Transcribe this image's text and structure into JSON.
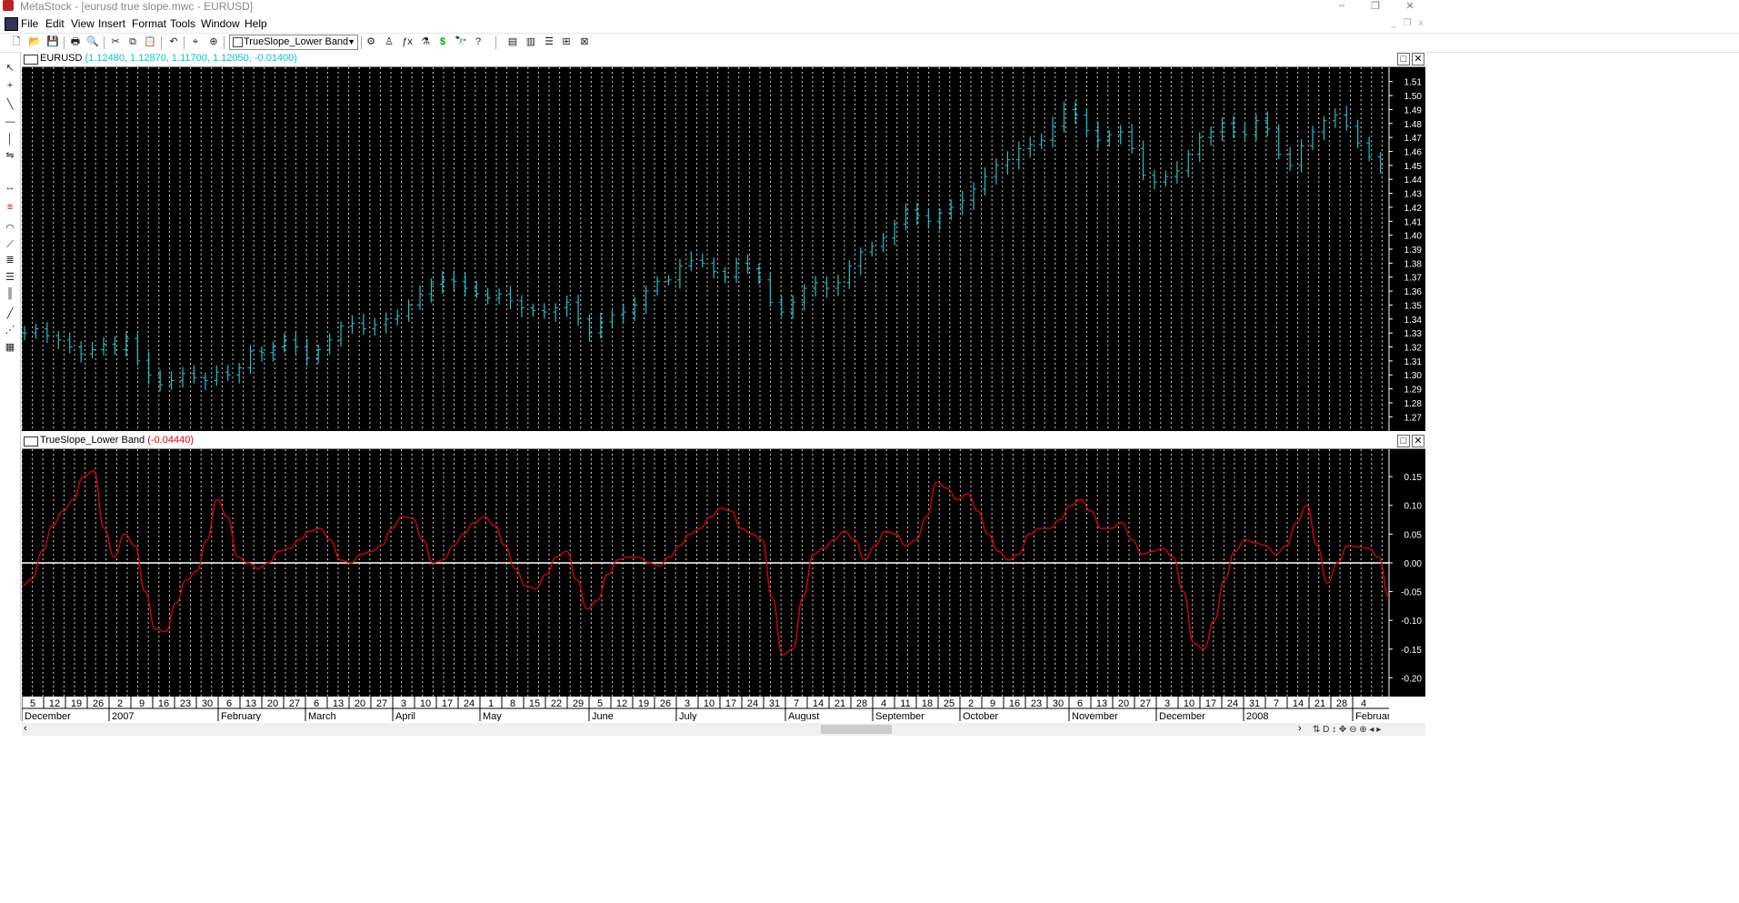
{
  "app": {
    "title": "MetaStock - [eurusd true slope.mwc - EURUSD]",
    "minimize": "–",
    "restore": "❐",
    "close": "✕"
  },
  "menu": [
    "File",
    "Edit",
    "View",
    "Insert",
    "Format",
    "Tools",
    "Window",
    "Help"
  ],
  "toolbar": {
    "indicator_combo": "TrueSlope_Lower Band"
  },
  "price_pane": {
    "symbol": "EURUSD",
    "values": "(1.12480, 1.12870, 1.11700, 1.12050, -0.01400)",
    "value_color": "#00c8c8",
    "bar_color": "#20c0c8",
    "y_ticks": [
      "1.51",
      "1.50",
      "1.49",
      "1.48",
      "1.47",
      "1.46",
      "1.45",
      "1.44",
      "1.43",
      "1.42",
      "1.41",
      "1.40",
      "1.39",
      "1.38",
      "1.37",
      "1.36",
      "1.35",
      "1.34",
      "1.33",
      "1.32",
      "1.31",
      "1.30",
      "1.29",
      "1.28",
      "1.27"
    ]
  },
  "indicator_pane": {
    "name": "TrueSlope_Lower Band",
    "value": "(-0.04440)",
    "value_color": "#e00000",
    "line_color": "#e00000",
    "zero_line_color": "#ffffff",
    "y_ticks": [
      "0.15",
      "0.10",
      "0.05",
      "0.00",
      "-0.05",
      "-0.10",
      "-0.15",
      "-0.20"
    ]
  },
  "x_axis": {
    "day_ticks": [
      "5",
      "12",
      "19",
      "26",
      "2",
      "9",
      "16",
      "23",
      "30",
      "6",
      "13",
      "20",
      "27",
      "6",
      "13",
      "20",
      "27",
      "3",
      "10",
      "17",
      "24",
      "1",
      "8",
      "15",
      "22",
      "29",
      "5",
      "12",
      "19",
      "26",
      "3",
      "10",
      "17",
      "24",
      "31",
      "7",
      "14",
      "21",
      "28",
      "4",
      "11",
      "18",
      "25",
      "2",
      "9",
      "16",
      "23",
      "30",
      "6",
      "13",
      "20",
      "27",
      "3",
      "10",
      "17",
      "24",
      "31",
      "7",
      "14",
      "21",
      "28",
      "4"
    ],
    "months": [
      {
        "label": "December",
        "tick": 0
      },
      {
        "label": "2007",
        "tick": 4
      },
      {
        "label": "February",
        "tick": 9
      },
      {
        "label": "March",
        "tick": 13
      },
      {
        "label": "April",
        "tick": 17
      },
      {
        "label": "May",
        "tick": 21
      },
      {
        "label": "June",
        "tick": 26
      },
      {
        "label": "July",
        "tick": 30
      },
      {
        "label": "August",
        "tick": 35
      },
      {
        "label": "September",
        "tick": 39
      },
      {
        "label": "October",
        "tick": 43
      },
      {
        "label": "November",
        "tick": 48
      },
      {
        "label": "December",
        "tick": 52
      },
      {
        "label": "2008",
        "tick": 56
      },
      {
        "label": "February",
        "tick": 61
      }
    ]
  },
  "chart_data": {
    "type": "line",
    "price_series": {
      "name": "EURUSD",
      "close_points": [
        1.33,
        1.333,
        1.328,
        1.325,
        1.32,
        1.315,
        1.318,
        1.322,
        1.318,
        1.326,
        1.31,
        1.3,
        1.293,
        1.296,
        1.301,
        1.298,
        1.296,
        1.302,
        1.3,
        1.305,
        1.317,
        1.316,
        1.32,
        1.325,
        1.32,
        1.312,
        1.318,
        1.325,
        1.335,
        1.337,
        1.333,
        1.336,
        1.34,
        1.342,
        1.35,
        1.358,
        1.365,
        1.368,
        1.367,
        1.362,
        1.358,
        1.355,
        1.358,
        1.353,
        1.348,
        1.346,
        1.345,
        1.348,
        1.352,
        1.34,
        1.33,
        1.338,
        1.343,
        1.345,
        1.35,
        1.36,
        1.367,
        1.368,
        1.378,
        1.382,
        1.38,
        1.374,
        1.37,
        1.38,
        1.376,
        1.368,
        1.352,
        1.345,
        1.352,
        1.362,
        1.366,
        1.362,
        1.366,
        1.378,
        1.388,
        1.392,
        1.398,
        1.408,
        1.418,
        1.414,
        1.41,
        1.416,
        1.42,
        1.425,
        1.433,
        1.442,
        1.45,
        1.454,
        1.462,
        1.465,
        1.468,
        1.478,
        1.49,
        1.486,
        1.475,
        1.468,
        1.472,
        1.474,
        1.462,
        1.443,
        1.438,
        1.442,
        1.446,
        1.458,
        1.47,
        1.474,
        1.48,
        1.474,
        1.472,
        1.482,
        1.476,
        1.458,
        1.45,
        1.464,
        1.474,
        1.482,
        1.486,
        1.478,
        1.466,
        1.456,
        1.45
      ],
      "y_range": [
        1.265,
        1.515
      ]
    },
    "indicator_series": {
      "name": "TrueSlope_Lower Band",
      "points": [
        -0.04,
        -0.028,
        0.02,
        0.065,
        0.09,
        0.11,
        0.15,
        0.16,
        0.06,
        0.01,
        0.05,
        0.03,
        -0.05,
        -0.115,
        -0.12,
        -0.07,
        -0.03,
        -0.015,
        0.04,
        0.11,
        0.08,
        0.01,
        0.0,
        -0.01,
        0.0,
        0.02,
        0.025,
        0.04,
        0.055,
        0.06,
        0.04,
        0.005,
        0.0,
        0.015,
        0.02,
        0.03,
        0.06,
        0.08,
        0.078,
        0.04,
        0.0,
        0.005,
        0.03,
        0.05,
        0.07,
        0.08,
        0.065,
        0.03,
        -0.01,
        -0.04,
        -0.045,
        -0.02,
        0.01,
        0.02,
        -0.03,
        -0.08,
        -0.065,
        -0.02,
        0.005,
        0.01,
        0.01,
        0.0,
        -0.005,
        0.01,
        0.03,
        0.05,
        0.06,
        0.08,
        0.095,
        0.09,
        0.06,
        0.05,
        0.04,
        -0.06,
        -0.16,
        -0.15,
        -0.06,
        0.015,
        0.025,
        0.04,
        0.055,
        0.04,
        0.005,
        0.03,
        0.055,
        0.05,
        0.03,
        0.04,
        0.08,
        0.14,
        0.13,
        0.11,
        0.12,
        0.09,
        0.05,
        0.02,
        0.005,
        0.015,
        0.05,
        0.06,
        0.06,
        0.075,
        0.1,
        0.11,
        0.09,
        0.06,
        0.06,
        0.07,
        0.04,
        0.015,
        0.02,
        0.025,
        0.01,
        -0.05,
        -0.14,
        -0.15,
        -0.1,
        -0.03,
        0.02,
        0.04,
        0.035,
        0.03,
        0.015,
        0.03,
        0.07,
        0.1,
        0.03,
        -0.035,
        0.0,
        0.03,
        0.028,
        0.025,
        0.01,
        -0.06
      ],
      "y_range": [
        -0.22,
        0.185
      ]
    }
  }
}
